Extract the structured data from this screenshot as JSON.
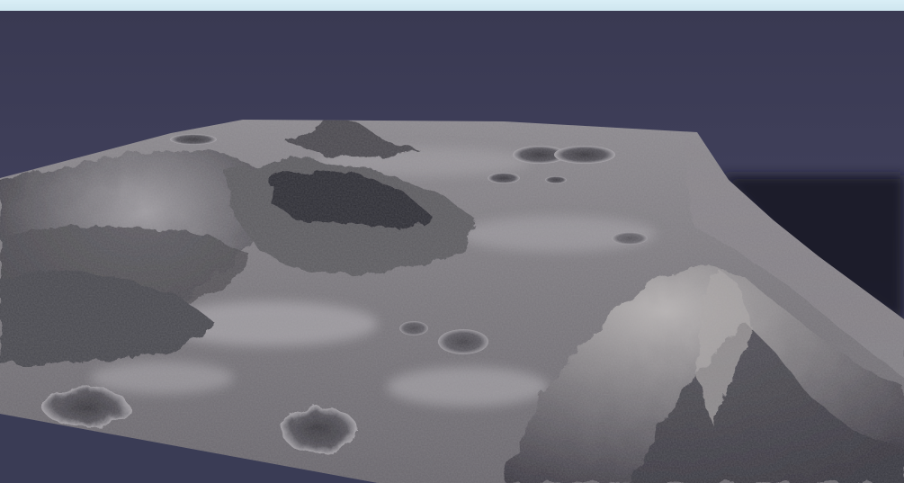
{
  "scene": {
    "subject": "terrain-render",
    "colors": {
      "sky_top": "#3a3a54",
      "sky_bottom": "#4e4e6c",
      "ground_plane": "#3a3c55",
      "terrain_light": "#a5a3a6",
      "terrain_mid": "#6f6d72",
      "terrain_dark": "#2d2b30",
      "top_bar": "#d4eaf2"
    }
  }
}
